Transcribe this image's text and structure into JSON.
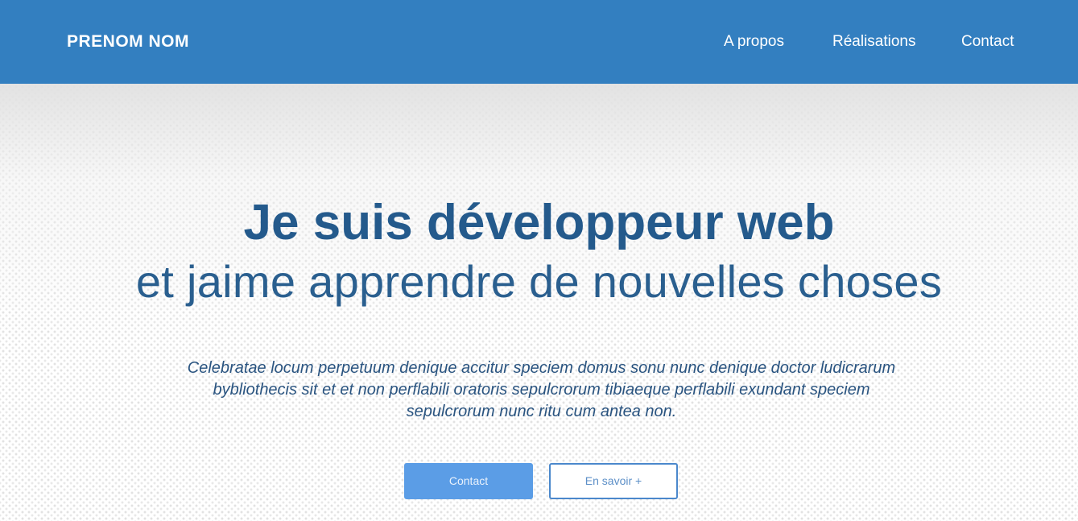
{
  "header": {
    "brand": "PRENOM NOM",
    "nav": [
      {
        "label": "A propos"
      },
      {
        "label": "Réalisations"
      },
      {
        "label": "Contact"
      }
    ]
  },
  "hero": {
    "headline": "Je suis développeur web",
    "subheadline": "et jaime apprendre de nouvelles choses",
    "intro": "Celebratae locum perpetuum denique accitur speciem domus sonu nunc denique doctor ludicrarum bybliothecis sit et et non perflabili oratoris sepulcrorum tibiaeque perflabili exundant speciem sepulcrorum nunc ritu cum antea non.",
    "buttons": {
      "primary_label": "Contact",
      "secondary_label": "En savoir +"
    }
  },
  "colors": {
    "navbar": "#337fc0",
    "headline": "#245a8c",
    "button_primary": "#5b9de6",
    "button_outline_border": "#4b88cc"
  }
}
